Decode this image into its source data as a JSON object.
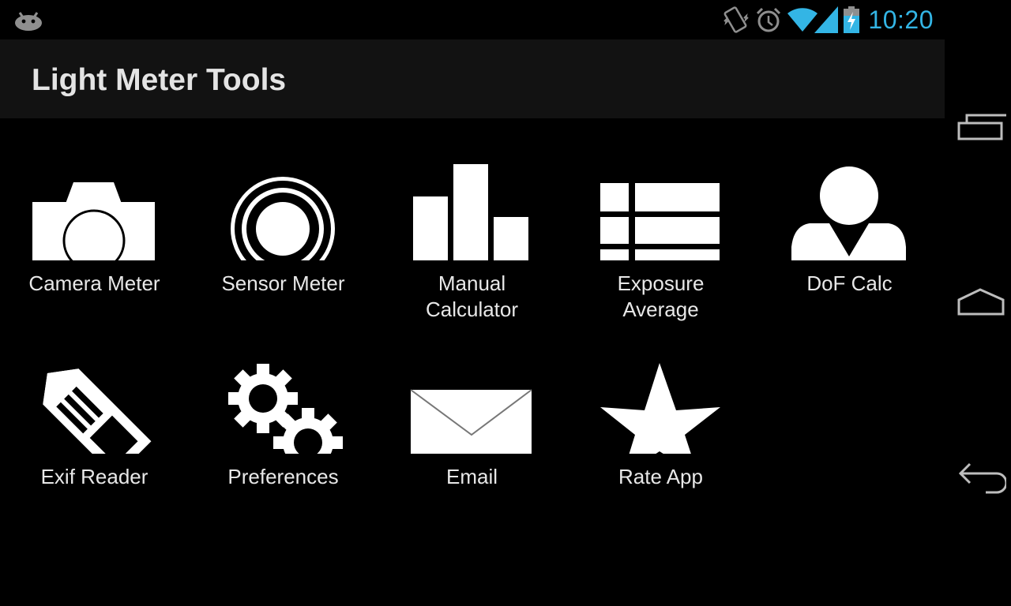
{
  "status_bar": {
    "time": "10:20",
    "time_color": "#33b5e5",
    "icons": [
      "android-notification-icon",
      "vibrate-icon",
      "alarm-icon",
      "wifi-icon",
      "signal-icon",
      "battery-charging-icon"
    ]
  },
  "app": {
    "title": "Light Meter Tools"
  },
  "tiles": [
    {
      "label": "Camera Meter",
      "icon": "camera-icon"
    },
    {
      "label": "Sensor Meter",
      "icon": "sensor-ring-icon"
    },
    {
      "label": "Manual\nCalculator",
      "icon": "bar-chart-icon"
    },
    {
      "label": "Exposure\nAverage",
      "icon": "list-table-icon"
    },
    {
      "label": "DoF Calc",
      "icon": "person-icon"
    },
    {
      "label": "Exif Reader",
      "icon": "tag-icon"
    },
    {
      "label": "Preferences",
      "icon": "gears-icon"
    },
    {
      "label": "Email",
      "icon": "envelope-icon"
    },
    {
      "label": "Rate App",
      "icon": "star-icon"
    }
  ],
  "nav_bar": {
    "buttons": [
      "recent-apps-icon",
      "home-icon",
      "back-icon"
    ]
  }
}
